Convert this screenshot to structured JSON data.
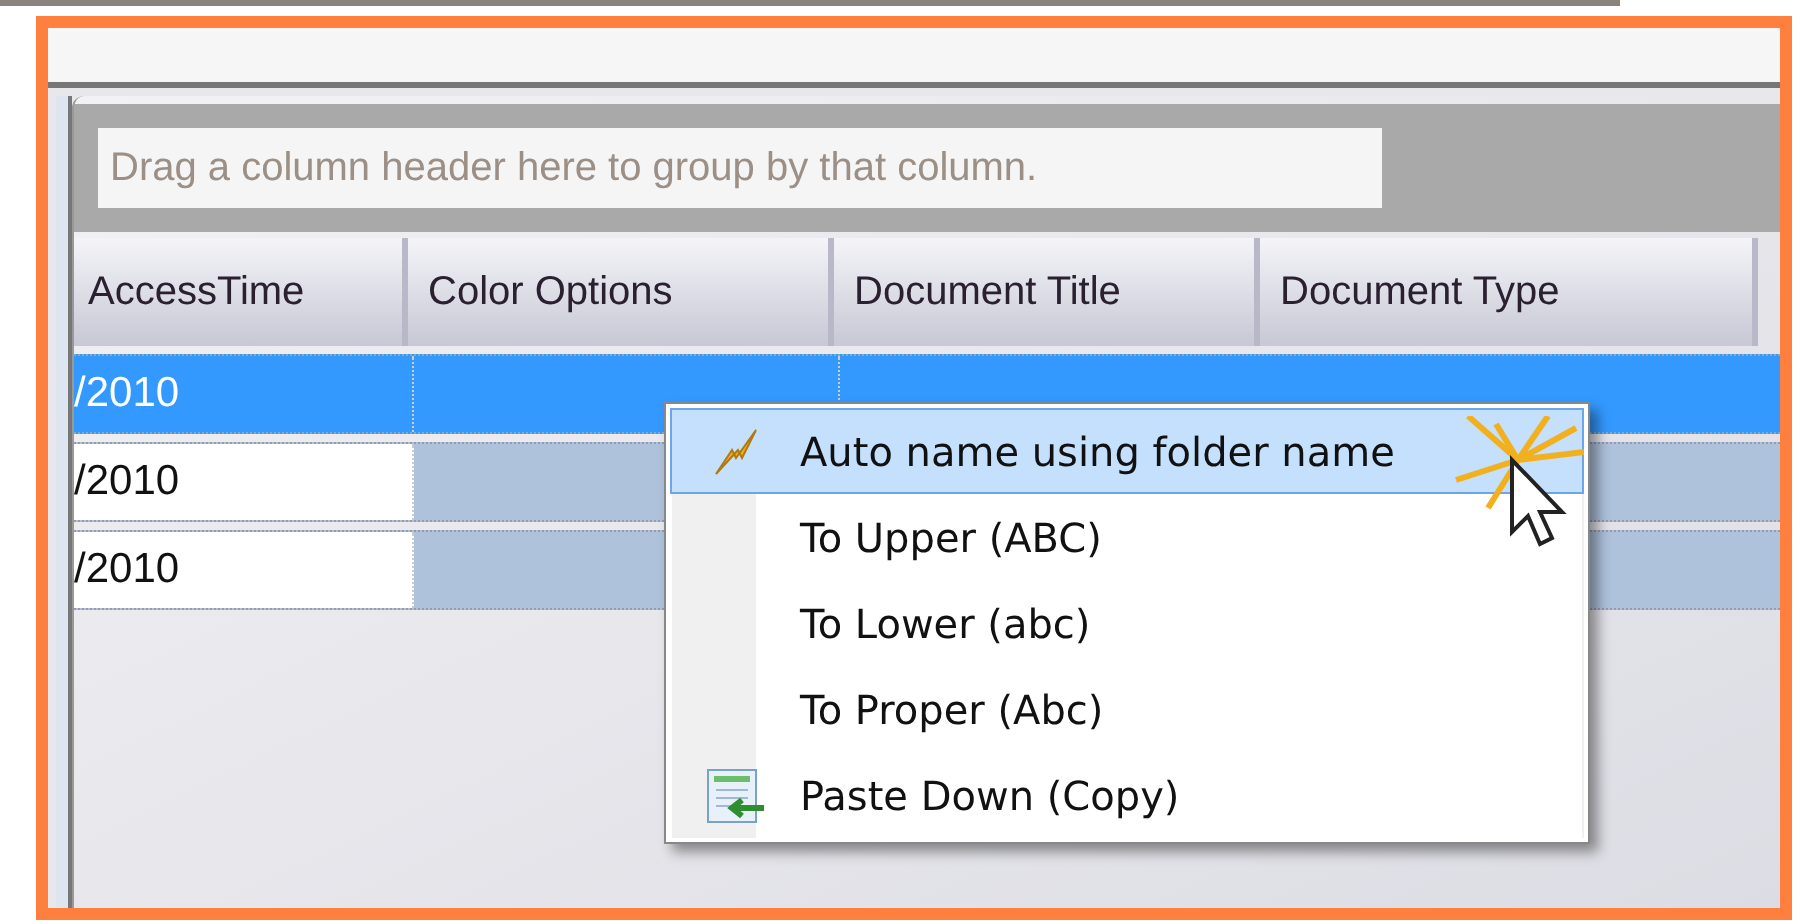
{
  "group_panel": {
    "placeholder": "Drag a column header here to group by that column."
  },
  "columns": [
    "AccessTime",
    "Color Options",
    "Document Title",
    "Document Type"
  ],
  "rows": [
    {
      "selected": true,
      "access_time": "/2010"
    },
    {
      "selected": false,
      "access_time": "/2010"
    },
    {
      "selected": false,
      "access_time": "/2010"
    }
  ],
  "context_menu": [
    {
      "label": "Auto name using folder name",
      "selected": true,
      "kind": "bolt"
    },
    {
      "label": "To Upper (ABC)",
      "selected": false,
      "kind": "plain"
    },
    {
      "label": "To Lower (abc)",
      "selected": false,
      "kind": "plain"
    },
    {
      "label": "To Proper (Abc)",
      "selected": false,
      "kind": "plain"
    },
    {
      "label": "Paste Down (Copy)",
      "selected": false,
      "kind": "paste"
    }
  ]
}
